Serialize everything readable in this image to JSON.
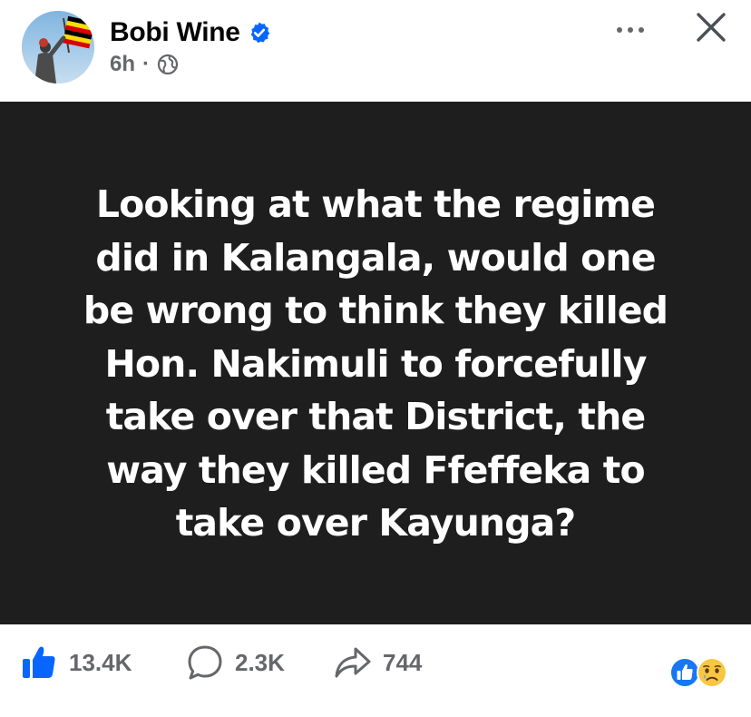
{
  "post": {
    "author": "Bobi Wine",
    "verified": true,
    "time": "6h",
    "separator": "·",
    "audience_icon": "globe-icon"
  },
  "header_actions": {
    "more_icon": "more-horizontal-icon",
    "close_icon": "close-icon"
  },
  "card": {
    "background": "#1e1e1e",
    "text_color": "#ffffff",
    "lines": [
      "Looking at what the regime",
      "did in Kalangala, would one",
      "be wrong to think they killed",
      "Hon. Nakimuli to forcefully",
      "take over that District, the",
      "way they killed Ffeffeka to",
      "take over Kayunga?"
    ]
  },
  "footer": {
    "like": {
      "icon": "thumbs-up-icon",
      "count": "13.4K",
      "color": "#0866ff"
    },
    "comment": {
      "icon": "comment-bubble-icon",
      "count": "2.3K"
    },
    "share": {
      "icon": "share-arrow-icon",
      "count": "744"
    },
    "reactions": [
      "like-reaction-icon",
      "sad-reaction-icon"
    ]
  },
  "colors": {
    "accent": "#0866ff",
    "muted": "#65676b",
    "sad_emoji": "#f7c744"
  }
}
